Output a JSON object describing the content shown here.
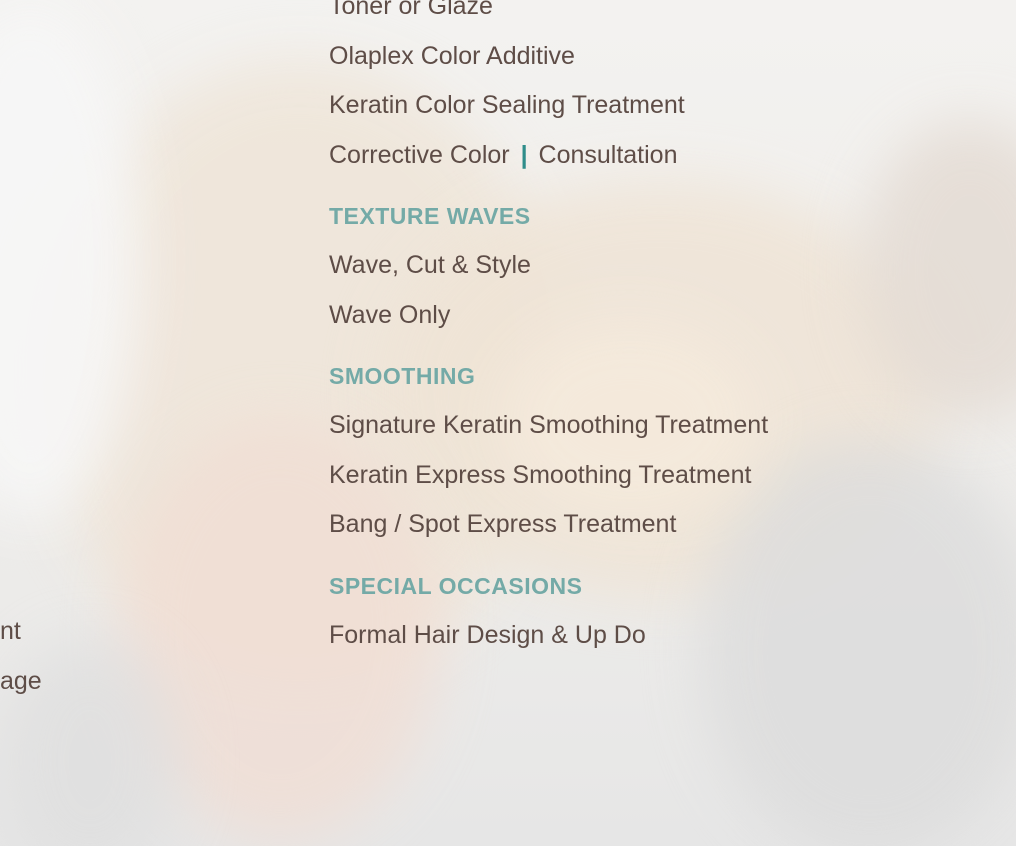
{
  "menu": {
    "color_items": {
      "toner": "Toner or Glaze",
      "olaplex": "Olaplex Color Additive",
      "keratin_sealing": "Keratin Color Sealing Treatment",
      "corrective": {
        "left": "Corrective Color",
        "separator": "|",
        "right": "Consultation"
      }
    },
    "texture_waves": {
      "heading": "TEXTURE WAVES",
      "items": [
        "Wave, Cut & Style",
        "Wave Only"
      ]
    },
    "smoothing": {
      "heading": "SMOOTHING",
      "items": [
        "Signature Keratin Smoothing Treatment",
        "Keratin Express Smoothing Treatment",
        "Bang / Spot Express Treatment"
      ]
    },
    "special_occasions": {
      "heading": "SPECIAL OCCASIONS",
      "items": [
        "Formal Hair Design & Up Do"
      ]
    }
  },
  "left_column_fragments": [
    "nt",
    "age"
  ],
  "colors": {
    "heading": "#74aaa7",
    "item_text": "#5e4d47",
    "separator": "#2f8d8a"
  }
}
